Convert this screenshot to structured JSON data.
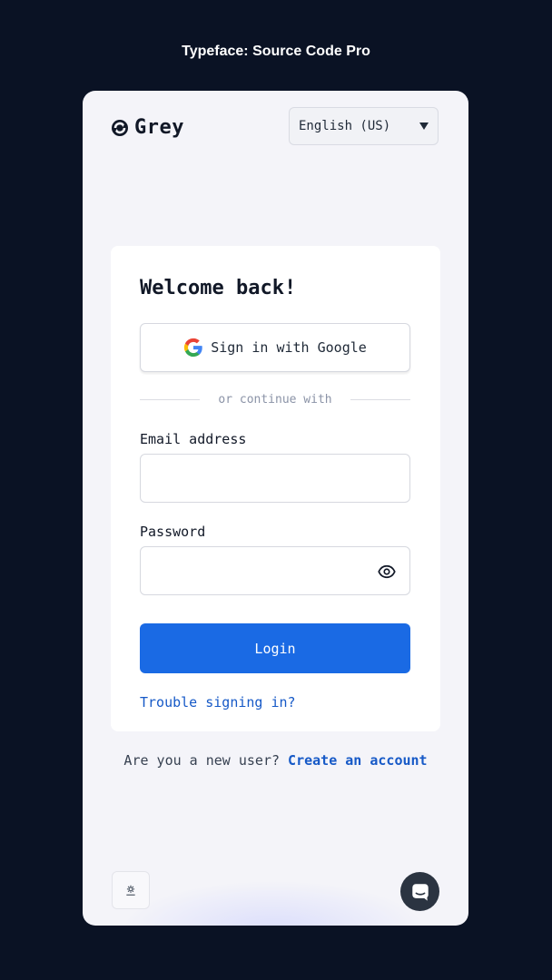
{
  "caption": "Typeface: Source Code Pro",
  "brand": {
    "name": "Grey"
  },
  "language": {
    "selected": "English (US)"
  },
  "card": {
    "title": "Welcome back!",
    "google_label": "Sign in with Google",
    "divider_text": "or continue with",
    "email_label": "Email address",
    "email_value": "",
    "password_label": "Password",
    "password_value": "",
    "login_label": "Login",
    "trouble_link": "Trouble signing in?"
  },
  "footer": {
    "new_user_text": "Are you a new user?",
    "create_link": "Create an account"
  },
  "colors": {
    "background": "#0a1224",
    "panel": "#f4f4f9",
    "primary": "#1a6ae4",
    "link": "#1659c7"
  },
  "icons": [
    "grey-logo-icon",
    "chevron-down-icon",
    "google-icon",
    "eye-icon",
    "settings-icon",
    "chat-icon"
  ]
}
